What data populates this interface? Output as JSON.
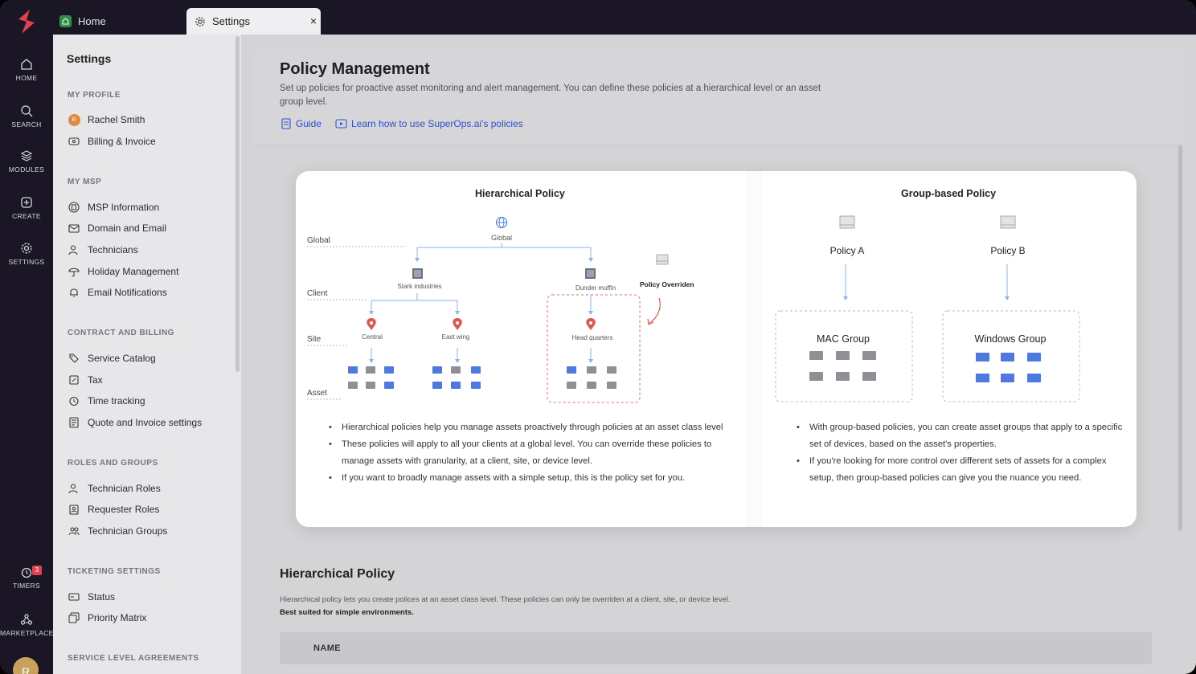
{
  "rail": {
    "items": [
      {
        "label": "HOME",
        "icon": "home-icon"
      },
      {
        "label": "SEARCH",
        "icon": "search-icon"
      },
      {
        "label": "MODULES",
        "icon": "layers-icon"
      },
      {
        "label": "CREATE",
        "icon": "plus-square-icon"
      },
      {
        "label": "SETTINGS",
        "icon": "gear-icon"
      },
      {
        "label": "TIMERS",
        "icon": "timer-icon"
      },
      {
        "label": "MARKETPLACE",
        "icon": "marketplace-icon"
      }
    ],
    "timers_badge": "3",
    "avatar_initial": "R"
  },
  "tabs": {
    "home_label": "Home",
    "settings_label": "Settings",
    "close_glyph": "×"
  },
  "settings": {
    "title": "Settings",
    "sections": [
      {
        "title": "MY PROFILE",
        "items": [
          "Rachel Smith",
          "Billing & Invoice"
        ]
      },
      {
        "title": "MY MSP",
        "items": [
          "MSP Information",
          "Domain and Email",
          "Technicians",
          "Holiday Management",
          "Email Notifications"
        ]
      },
      {
        "title": "CONTRACT AND BILLING",
        "items": [
          "Service Catalog",
          "Tax",
          "Time tracking",
          "Quote and Invoice settings"
        ]
      },
      {
        "title": "ROLES AND GROUPS",
        "items": [
          "Technician Roles",
          "Requester Roles",
          "Technician Groups"
        ]
      },
      {
        "title": "TICKETING SETTINGS",
        "items": [
          "Status",
          "Priority Matrix"
        ]
      },
      {
        "title": "SERVICE LEVEL AGREEMENTS",
        "items": []
      }
    ],
    "profile_initial": "R"
  },
  "main": {
    "title": "Policy Management",
    "description": "Set up policies for proactive asset monitoring and alert management. You can define these policies at a hierarchical level or an asset group level.",
    "guide_label": "Guide",
    "learn_label": "Learn how to use SuperOps.ai's policies",
    "diagram": {
      "hier_title": "Hierarchical Policy",
      "group_title": "Group-based Policy",
      "levels": [
        "Global",
        "Client",
        "Site",
        "Asset"
      ],
      "global_node": "Global",
      "clients": [
        "Stark industries",
        "Dunder muffin"
      ],
      "sites": [
        "Central",
        "East wing",
        "Head quarters"
      ],
      "override_label": "Policy Overriden",
      "policies": [
        "Policy A",
        "Policy B"
      ],
      "groups": [
        "MAC  Group",
        "Windows Group"
      ],
      "hier_bullets": [
        "Hierarchical policies help you manage assets proactively through policies at an asset class level",
        "These policies will apply to all your clients at a global level. You can override these policies to manage assets with granularity, at a client, site, or device level.",
        "If you want to broadly manage assets with a simple setup, this is the policy set for you."
      ],
      "group_bullets": [
        "With group-based policies, you can create asset groups that apply to a specific set of devices, based on the asset's properties.",
        "If you're looking for more control over different sets of assets for a complex setup, then group-based policies can give you the nuance you need."
      ]
    },
    "section_title": "Hierarchical Policy",
    "section_desc": "Hierarchical policy lets you create polices at an asset class level. These policies can only be overriden at a client, site, or device level.",
    "section_note": "Best suited for simple environments.",
    "table_header": "NAME"
  },
  "colors": {
    "rail": "#1a1626",
    "accent_link": "#2f4fd1",
    "pin": "#e0564e",
    "mac_device": "#8f8f95",
    "win_device": "#4d79e0",
    "brand": "#e0414b"
  }
}
